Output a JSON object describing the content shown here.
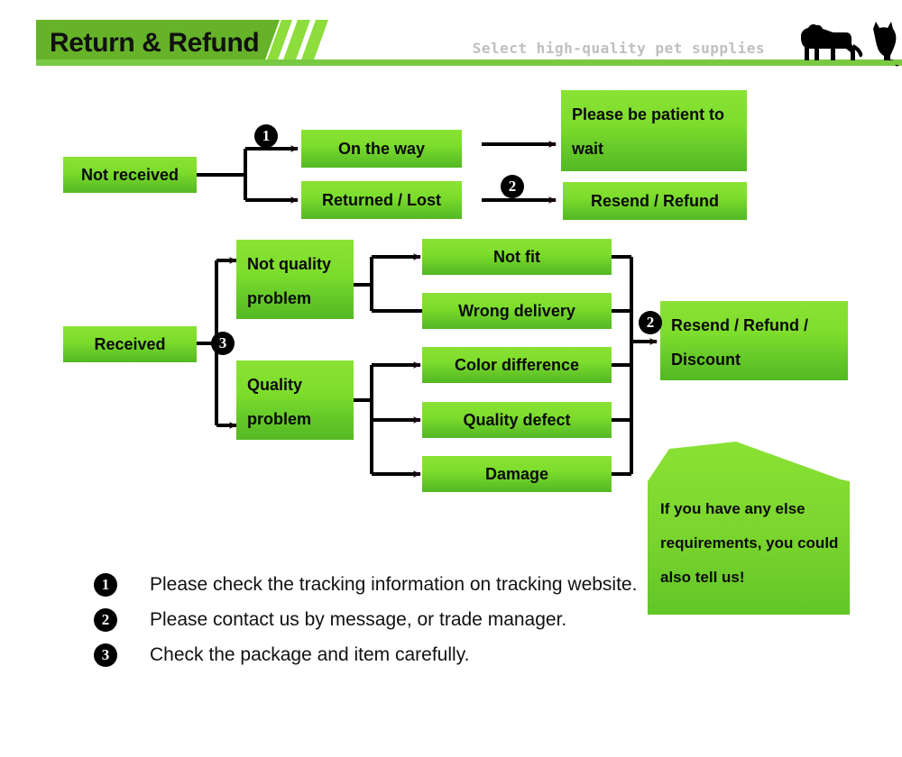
{
  "header": {
    "title": "Return & Refund",
    "tagline": "Select high-quality pet supplies",
    "banner_color": "#66b32a",
    "stripe_color": "#8ddd3c",
    "rule_color": "#7ac943",
    "tagline_color": "#bfbfbf",
    "pets_icon": "dog-and-cat-silhouette"
  },
  "flow": {
    "box_gradient_top": "#8ae234",
    "box_gradient_bottom": "#54b823",
    "markers": {
      "m1": "❶",
      "m2": "❷",
      "m3": "❸"
    },
    "marker_labels": {
      "one": "1",
      "two": "2",
      "three": "3"
    },
    "not_received": "Not received",
    "on_the_way": "On the way",
    "returned_lost": "Returned / Lost",
    "please_be_patient": "Please be patient to wait",
    "resend_refund": "Resend / Refund",
    "received": "Received",
    "not_quality_problem": "Not quality problem",
    "quality_problem": "Quality problem",
    "not_fit": "Not fit",
    "wrong_delivery": "Wrong delivery",
    "color_difference": "Color difference",
    "quality_defect": "Quality defect",
    "damage": "Damage",
    "resend_refund_discount": "Resend / Refund / Discount",
    "callout": "If you have any else requirements, you could also tell us!"
  },
  "legend": {
    "items": [
      {
        "num": "1",
        "text": "Please check the tracking information on tracking website."
      },
      {
        "num": "2",
        "text": "Please contact us by message, or trade manager."
      },
      {
        "num": "3",
        "text": "Check the package and item carefully."
      }
    ]
  }
}
